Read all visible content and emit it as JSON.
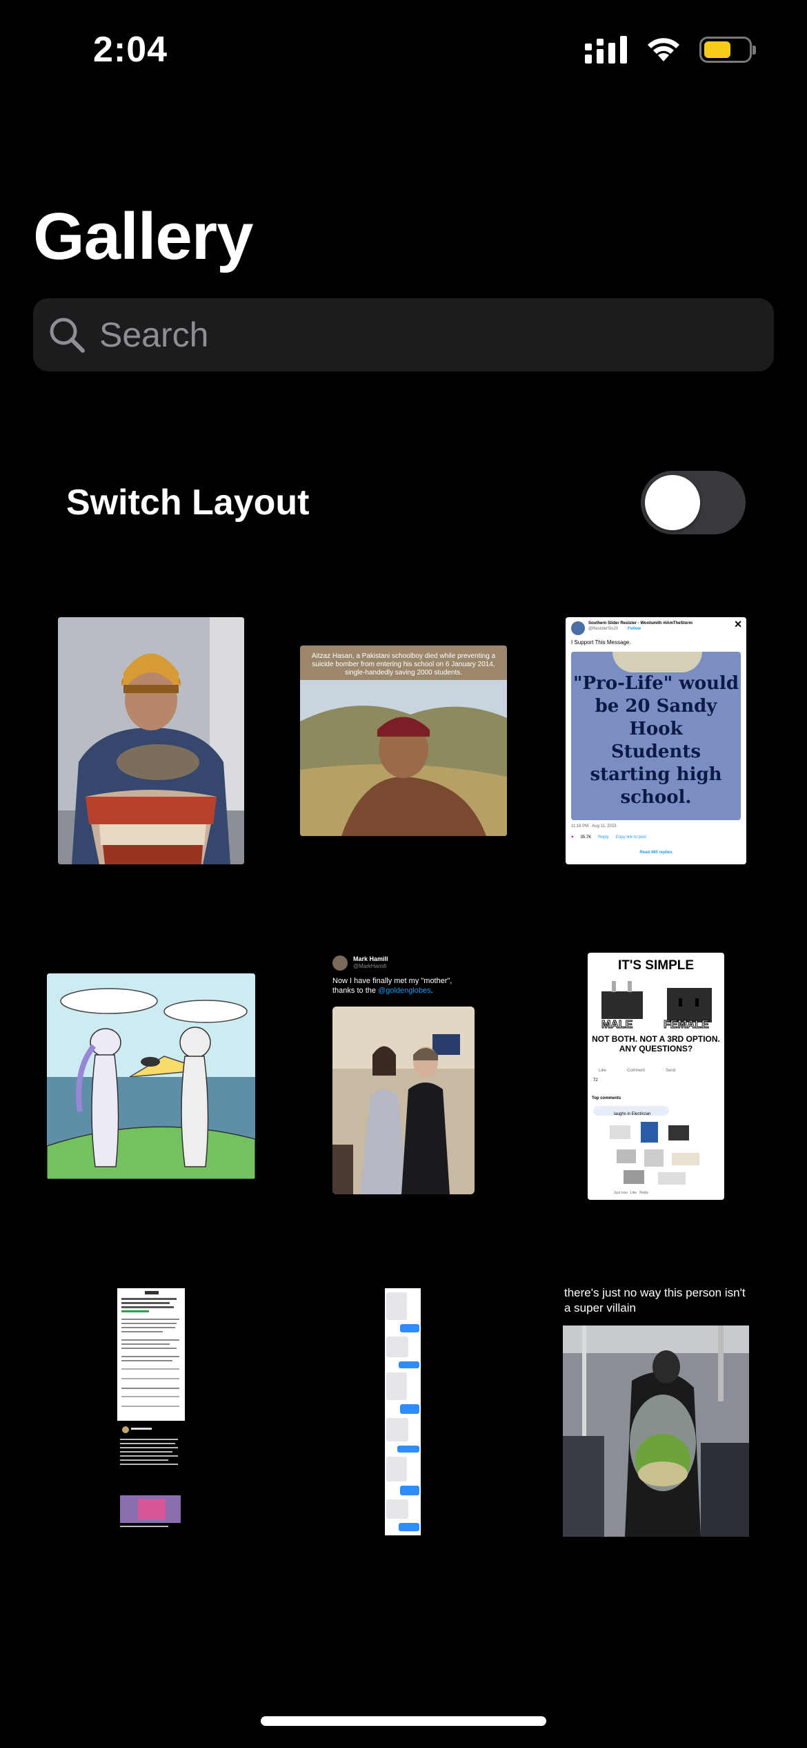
{
  "status_bar": {
    "time": "2:04",
    "battery_level": 0.62,
    "battery_color": "#f7cd1b",
    "icons": [
      "cellular-signal-icon",
      "wifi-icon",
      "battery-icon"
    ]
  },
  "page": {
    "title": "Gallery"
  },
  "search": {
    "placeholder": "Search",
    "value": ""
  },
  "layout_switch": {
    "label": "Switch Layout",
    "on": false
  },
  "gallery": {
    "items": [
      {
        "name": "man-holding-cat"
      },
      {
        "name": "aitzaz-hasan-meme",
        "caption": "Aitzaz Hasan, a Pakistani schoolboy died while preventing a suicide bomber from entering his school on 6 January 2014, single-handedly saving 2000 students."
      },
      {
        "name": "pro-life-shirt-tweet",
        "author": "Southern Slider Resister - Wordsmith #IAmTheStorm",
        "handle": "@ResisterSis20",
        "follow": "Follow",
        "text": "I Support This Message.",
        "shirt_lines": [
          "\"Pro-Life\" would",
          "be 20 Sandy Hook",
          "Students",
          "starting high",
          "school."
        ],
        "meta": "11:18 PM · Aug 11, 2023",
        "likes": "35.7K",
        "reply": "Reply",
        "copy": "Copy link to post",
        "read_replies": "Read 480 replies"
      },
      {
        "name": "comic-two-figures"
      },
      {
        "name": "mark-hamill-tweet",
        "author": "Mark Hamill",
        "handle": "@MarkHamill",
        "text_prefix": "Now I have finally met my \"mother\", thanks to the ",
        "mention": "@goldenglobes",
        "text_suffix": "."
      },
      {
        "name": "its-simple-plug-meme",
        "title": "IT'S SIMPLE",
        "male": "MALE",
        "female": "FEMALE",
        "body": "NOT BOTH. NOT A 3RD OPTION. ANY QUESTIONS?",
        "like": "Like",
        "comment": "Comment",
        "send": "Send",
        "reactions": "72",
        "top_comments": "Top comments",
        "reply_bubble": "laughs in Electrician",
        "footer": "Just now   Like   Reply"
      },
      {
        "name": "long-thread-screenshot"
      },
      {
        "name": "chat-messages-screenshot"
      },
      {
        "name": "aquarium-backpack",
        "caption": "there's just no way this person isn't a super villain"
      }
    ]
  },
  "colors": {
    "background": "#000000",
    "search_bg": "#1c1c1e",
    "toggle_track": "#39393d",
    "link_blue": "#1d9bf0"
  }
}
